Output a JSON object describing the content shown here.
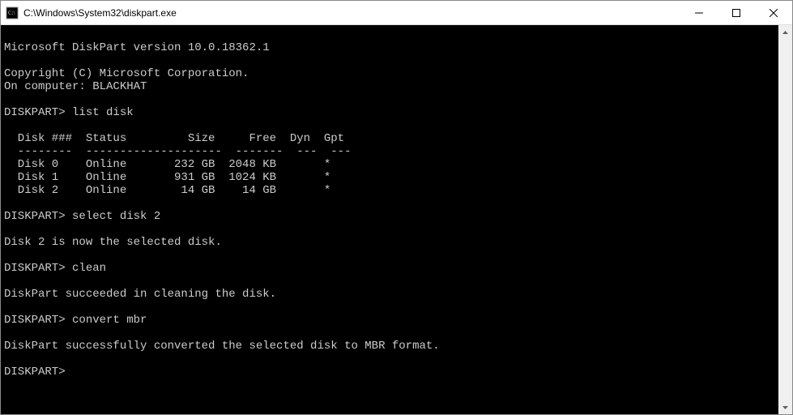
{
  "window": {
    "title": "C:\\Windows\\System32\\diskpart.exe"
  },
  "terminal": {
    "version_line": "Microsoft DiskPart version 10.0.18362.1",
    "copyright": "Copyright (C) Microsoft Corporation.",
    "computer_line": "On computer: BLACKHAT",
    "prompt": "DISKPART>",
    "cmd_list_disk": "list disk",
    "table": {
      "headers": {
        "disk": "Disk ###",
        "status": "Status",
        "size": "Size",
        "free": "Free",
        "dyn": "Dyn",
        "gpt": "Gpt"
      },
      "sep": {
        "disk": "--------",
        "status": "-------------",
        "size": "-------",
        "free": "-------",
        "dyn": "---",
        "gpt": "---"
      },
      "rows": [
        {
          "disk": "Disk 0",
          "status": "Online",
          "size": "232 GB",
          "free": "2048 KB",
          "dyn": "",
          "gpt": "*"
        },
        {
          "disk": "Disk 1",
          "status": "Online",
          "size": "931 GB",
          "free": "1024 KB",
          "dyn": "",
          "gpt": "*"
        },
        {
          "disk": "Disk 2",
          "status": "Online",
          "size": "14 GB",
          "free": "14 GB",
          "dyn": "",
          "gpt": "*"
        }
      ]
    },
    "cmd_select": "select disk 2",
    "msg_selected": "Disk 2 is now the selected disk.",
    "cmd_clean": "clean",
    "msg_cleaned": "DiskPart succeeded in cleaning the disk.",
    "cmd_convert": "convert mbr",
    "msg_converted": "DiskPart successfully converted the selected disk to MBR format."
  }
}
